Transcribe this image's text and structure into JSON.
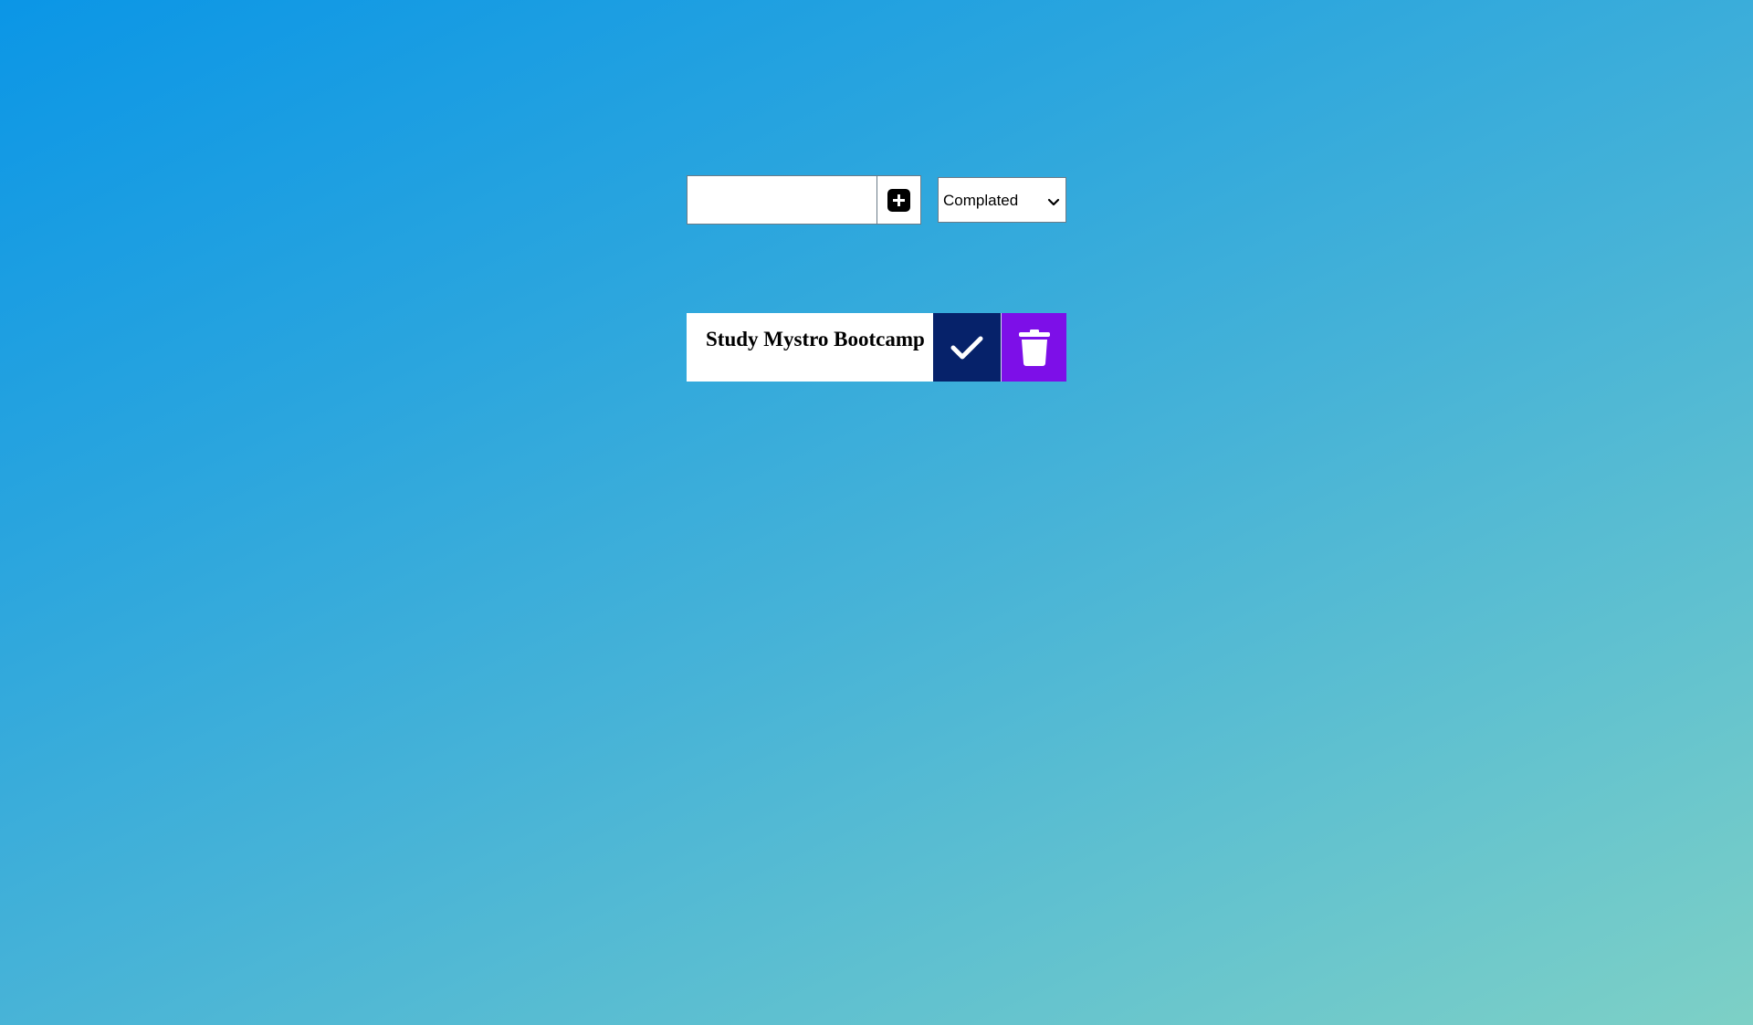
{
  "form": {
    "input_value": "",
    "add_icon": "plus-square-icon",
    "filter": {
      "selected": "Complated",
      "icon": "chevron-down-icon"
    }
  },
  "todos": [
    {
      "text": "Study Mystro Bootcamp",
      "complete_icon": "check-icon",
      "delete_icon": "trash-icon"
    }
  ],
  "colors": {
    "complete_button": "#06226a",
    "delete_button": "#7d0fe8",
    "background_start": "#0b96e6",
    "background_end": "#7dd0c6"
  }
}
